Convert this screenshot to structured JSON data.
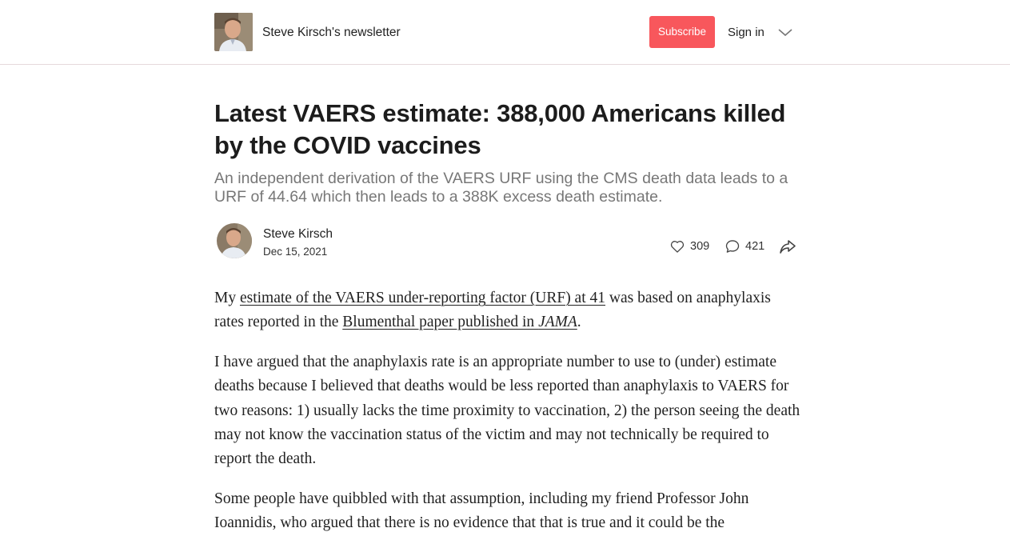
{
  "header": {
    "publication_name": "Steve Kirsch's newsletter",
    "subscribe_label": "Subscribe",
    "signin_label": "Sign in"
  },
  "post": {
    "title": "Latest VAERS estimate: 388,000 Americans killed by the COVID vaccines",
    "subtitle": "An independent derivation of the VAERS URF using the CMS death data leads to a URF of 44.64 which then leads to a 388K excess death estimate.",
    "author": "Steve Kirsch",
    "date": "Dec 15, 2021",
    "likes": "309",
    "comments": "421"
  },
  "body": {
    "p1": {
      "t1": "My ",
      "link1": "estimate of the VAERS under-reporting factor (URF) at 41",
      "t2": " was based on anaphylaxis rates reported in the ",
      "link2": "Blumenthal paper published in ",
      "link2_italic": "JAMA",
      "t3": "."
    },
    "p2": "I have argued that the anaphylaxis rate is an appropriate number to use to (under) estimate deaths because I believed that deaths would be less reported than anaphylaxis to VAERS for two reasons: 1) usually lacks the time proximity to vaccination, 2) the person seeing the death may not know the vaccination status of the victim and may not technically be required to report the death.",
    "p3": "Some people have quibbled with that assumption, including my friend Professor John Ioannidis, who argued that there is no evidence that that is true and it could be the"
  },
  "colors": {
    "subscribe_bg": "#f8575c",
    "divider": "#e6d9dc",
    "subtitle": "#777777"
  },
  "icons": [
    "publication-logo",
    "chevron-down-icon",
    "heart-icon",
    "comment-icon",
    "share-icon"
  ]
}
